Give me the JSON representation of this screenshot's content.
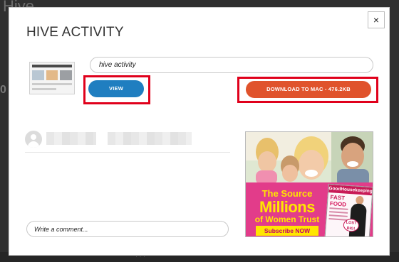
{
  "background": {
    "brand": "Hive",
    "side_glyph": "0",
    "footer_text": "· · ·"
  },
  "modal": {
    "title": "HIVE ACTIVITY",
    "close_label": "×",
    "name_value": "hive activity",
    "view_label": "VIEW",
    "download_label": "DOWNLOAD TO MAC - 476.2KB",
    "comment_placeholder": "Write a comment..."
  },
  "ad": {
    "line1": "The Source",
    "line2": "Millions",
    "line3": "of Women Trust",
    "cta": "Subscribe NOW",
    "magazine": {
      "title": "GoodHousekeeping",
      "fast": "FAST",
      "food": "FOOD",
      "badge_top": "LOST",
      "badge_bottom": "BIG!"
    }
  },
  "colors": {
    "view_button": "#1f7ec0",
    "download_button": "#e0532c",
    "highlight": "#e0001b",
    "ad_pink": "#e23c8a",
    "ad_yellow": "#ffe600"
  },
  "icons": {
    "close": "close-icon",
    "avatar": "user-avatar-icon"
  }
}
